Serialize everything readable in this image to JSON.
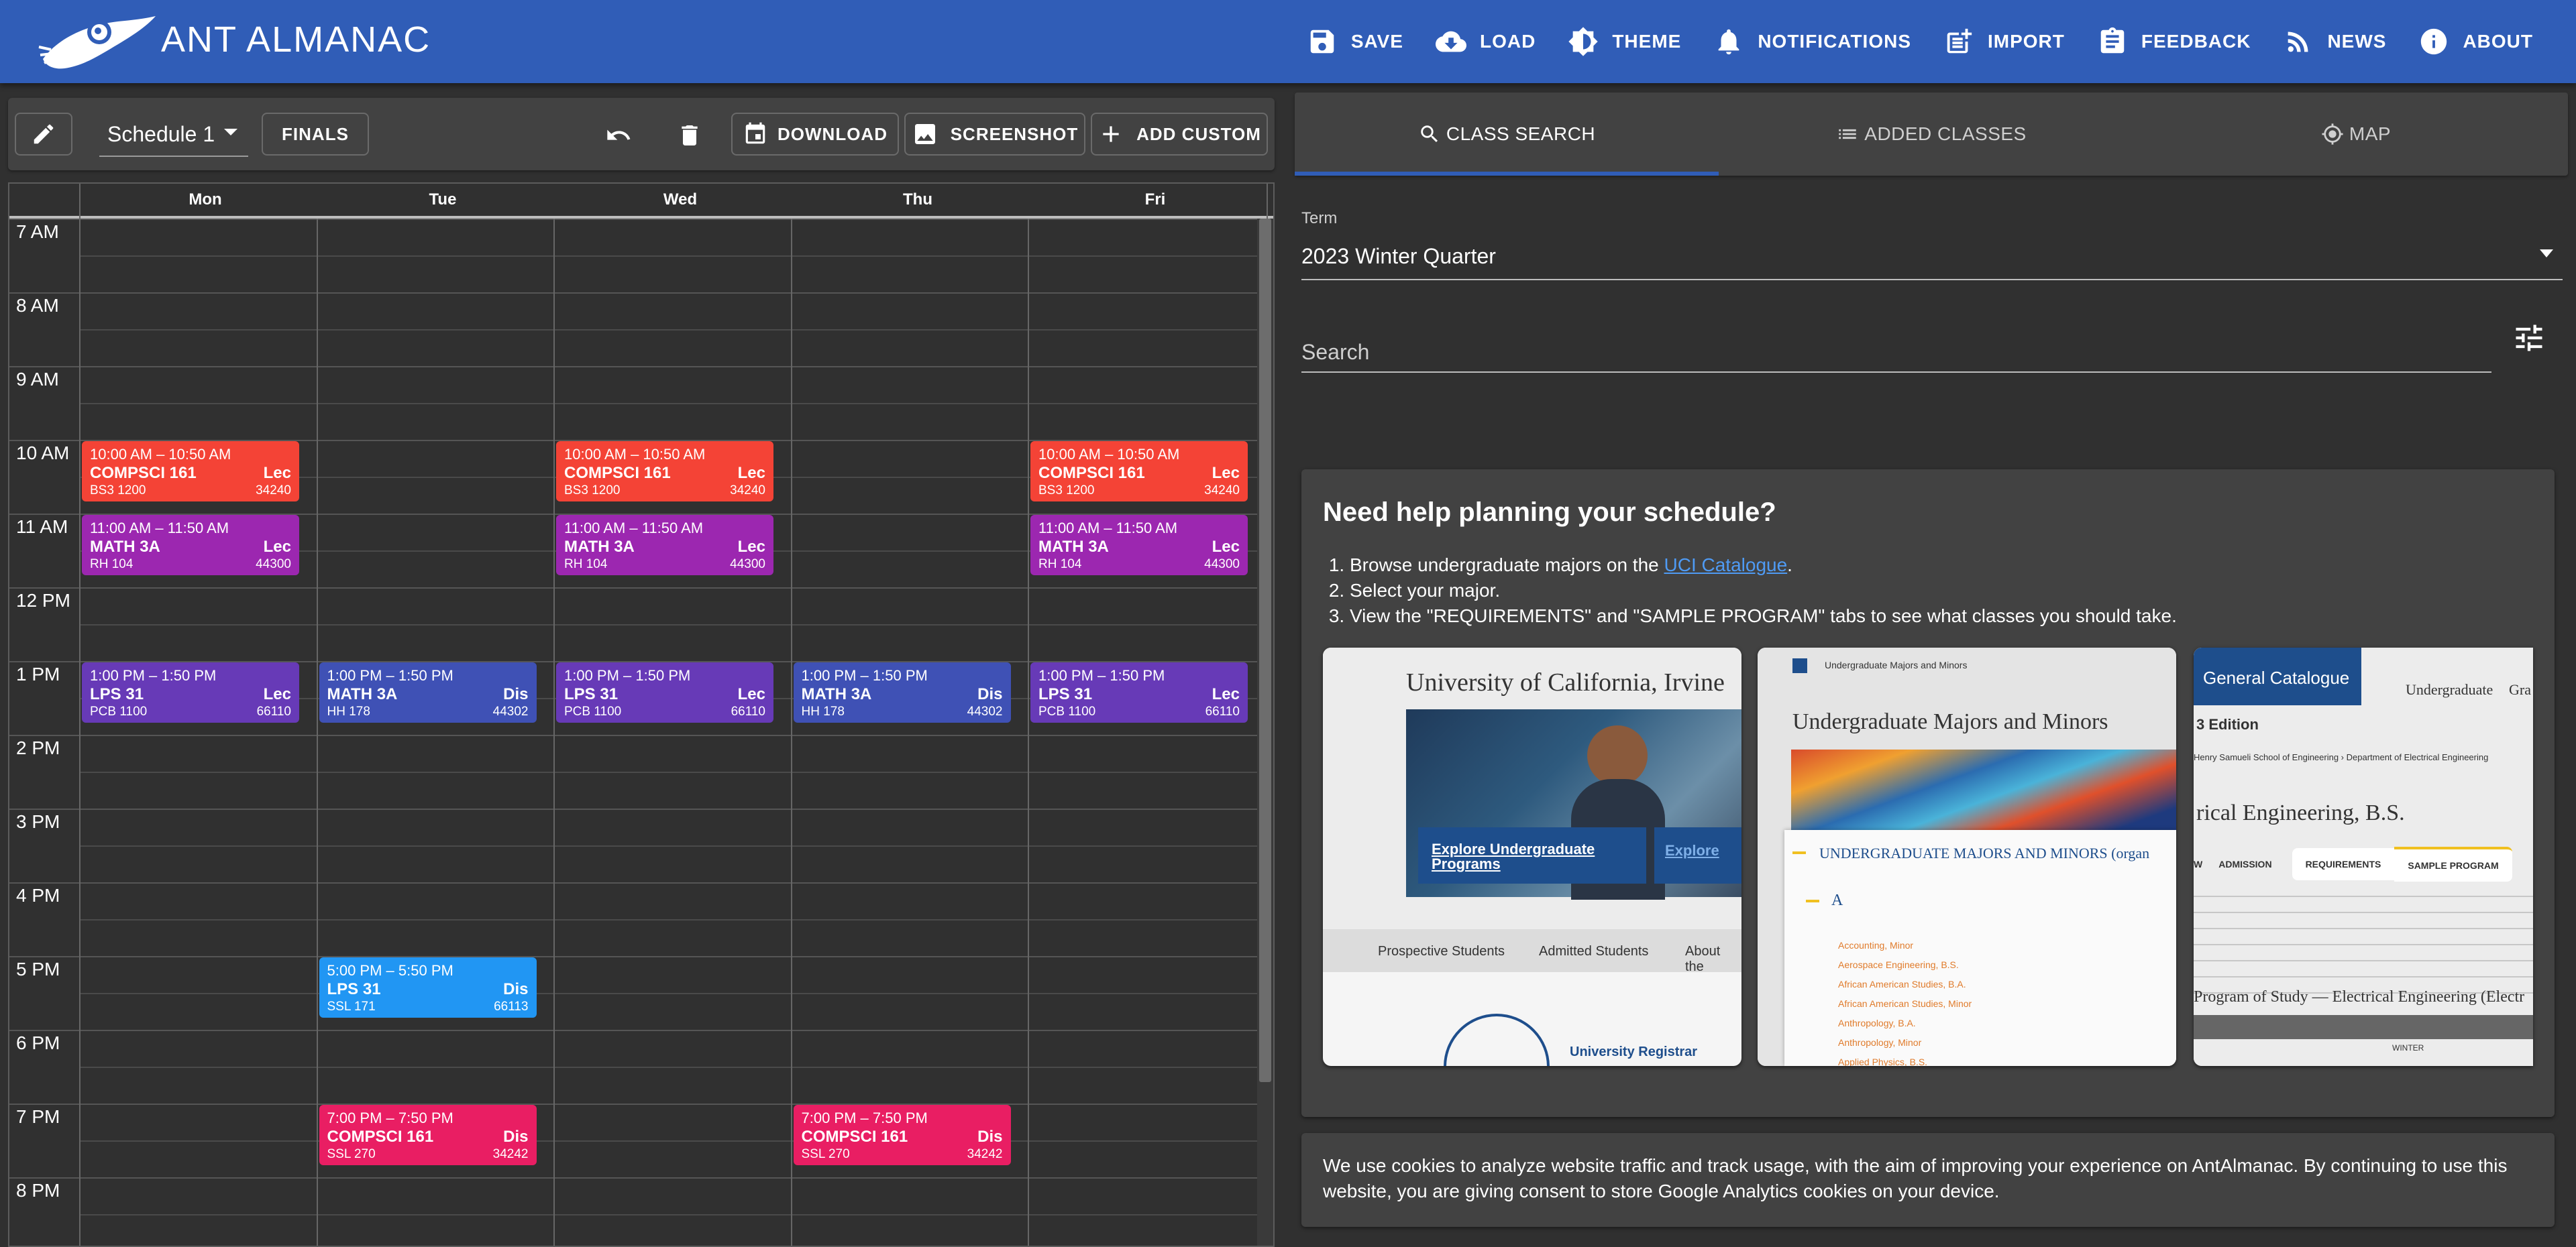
{
  "app": {
    "title": "ANT ALMANAC"
  },
  "nav": [
    {
      "label": "SAVE",
      "icon": "save-icon"
    },
    {
      "label": "LOAD",
      "icon": "cloud-download-icon"
    },
    {
      "label": "THEME",
      "icon": "brightness-icon"
    },
    {
      "label": "NOTIFICATIONS",
      "icon": "bell-icon"
    },
    {
      "label": "IMPORT",
      "icon": "post-add-icon"
    },
    {
      "label": "FEEDBACK",
      "icon": "clipboard-icon"
    },
    {
      "label": "NEWS",
      "icon": "rss-icon"
    },
    {
      "label": "ABOUT",
      "icon": "info-icon"
    }
  ],
  "toolbar": {
    "schedule_name": "Schedule 1",
    "finals_label": "FINALS",
    "download_label": "DOWNLOAD",
    "screenshot_label": "SCREENSHOT",
    "add_custom_label": "ADD CUSTOM"
  },
  "calendar": {
    "days": [
      "Mon",
      "Tue",
      "Wed",
      "Thu",
      "Fri"
    ],
    "hours": [
      "7 AM",
      "8 AM",
      "9 AM",
      "10 AM",
      "11 AM",
      "12 PM",
      "1 PM",
      "2 PM",
      "3 PM",
      "4 PM",
      "5 PM",
      "6 PM",
      "7 PM",
      "8 PM"
    ],
    "events": [
      {
        "day": 0,
        "start": 10,
        "time": "10:00 AM – 10:50 AM",
        "course": "COMPSCI 161",
        "type": "Lec",
        "room": "BS3 1200",
        "code": "34240",
        "color": "#f44336"
      },
      {
        "day": 2,
        "start": 10,
        "time": "10:00 AM – 10:50 AM",
        "course": "COMPSCI 161",
        "type": "Lec",
        "room": "BS3 1200",
        "code": "34240",
        "color": "#f44336"
      },
      {
        "day": 4,
        "start": 10,
        "time": "10:00 AM – 10:50 AM",
        "course": "COMPSCI 161",
        "type": "Lec",
        "room": "BS3 1200",
        "code": "34240",
        "color": "#f44336"
      },
      {
        "day": 0,
        "start": 11,
        "time": "11:00 AM – 11:50 AM",
        "course": "MATH 3A",
        "type": "Lec",
        "room": "RH 104",
        "code": "44300",
        "color": "#9c27b0"
      },
      {
        "day": 2,
        "start": 11,
        "time": "11:00 AM – 11:50 AM",
        "course": "MATH 3A",
        "type": "Lec",
        "room": "RH 104",
        "code": "44300",
        "color": "#9c27b0"
      },
      {
        "day": 4,
        "start": 11,
        "time": "11:00 AM – 11:50 AM",
        "course": "MATH 3A",
        "type": "Lec",
        "room": "RH 104",
        "code": "44300",
        "color": "#9c27b0"
      },
      {
        "day": 0,
        "start": 13,
        "time": "1:00 PM – 1:50 PM",
        "course": "LPS 31",
        "type": "Lec",
        "room": "PCB 1100",
        "code": "66110",
        "color": "#673ab7"
      },
      {
        "day": 2,
        "start": 13,
        "time": "1:00 PM – 1:50 PM",
        "course": "LPS 31",
        "type": "Lec",
        "room": "PCB 1100",
        "code": "66110",
        "color": "#673ab7"
      },
      {
        "day": 4,
        "start": 13,
        "time": "1:00 PM – 1:50 PM",
        "course": "LPS 31",
        "type": "Lec",
        "room": "PCB 1100",
        "code": "66110",
        "color": "#673ab7"
      },
      {
        "day": 1,
        "start": 13,
        "time": "1:00 PM – 1:50 PM",
        "course": "MATH 3A",
        "type": "Dis",
        "room": "HH 178",
        "code": "44302",
        "color": "#3f51b5"
      },
      {
        "day": 3,
        "start": 13,
        "time": "1:00 PM – 1:50 PM",
        "course": "MATH 3A",
        "type": "Dis",
        "room": "HH 178",
        "code": "44302",
        "color": "#3f51b5"
      },
      {
        "day": 1,
        "start": 17,
        "time": "5:00 PM – 5:50 PM",
        "course": "LPS 31",
        "type": "Dis",
        "room": "SSL 171",
        "code": "66113",
        "color": "#2196f3"
      },
      {
        "day": 1,
        "start": 19,
        "time": "7:00 PM – 7:50 PM",
        "course": "COMPSCI 161",
        "type": "Dis",
        "room": "SSL 270",
        "code": "34242",
        "color": "#e91e63"
      },
      {
        "day": 3,
        "start": 19,
        "time": "7:00 PM – 7:50 PM",
        "course": "COMPSCI 161",
        "type": "Dis",
        "room": "SSL 270",
        "code": "34242",
        "color": "#e91e63"
      }
    ]
  },
  "tabs": [
    {
      "label": "CLASS SEARCH",
      "icon": "search-icon",
      "active": true
    },
    {
      "label": "ADDED CLASSES",
      "icon": "list-icon",
      "active": false
    },
    {
      "label": "MAP",
      "icon": "location-icon",
      "active": false
    }
  ],
  "search": {
    "term_label": "Term",
    "term_value": "2023 Winter Quarter",
    "placeholder": "Search"
  },
  "help": {
    "title": "Need help planning your schedule?",
    "step1_prefix": "Browse undergraduate majors on the ",
    "step1_link": "UCI Catalogue",
    "step1_suffix": ".",
    "step2": "Select your major.",
    "step3": "View the \"REQUIREMENTS\" and \"SAMPLE PROGRAM\" tabs to see what classes you should take.",
    "shot1": {
      "heading": "University of California, Irvine",
      "button": "Explore Undergraduate Programs",
      "button2": "Explore",
      "nav": [
        "Prospective Students",
        "Admitted Students",
        "About the"
      ],
      "footer": "University Registrar"
    },
    "shot2": {
      "crumb": "Undergraduate Majors and Minors",
      "heading": "Undergraduate Majors and Minors",
      "section": "UNDERGRADUATE MAJORS AND MINORS (organ",
      "letter": "A",
      "items": [
        "Accounting, Minor",
        "Aerospace Engineering, B.S.",
        "African American Studies, B.A.",
        "African American Studies, Minor",
        "Anthropology, B.A.",
        "Anthropology, Minor",
        "Applied Physics, B.S."
      ]
    },
    "shot3": {
      "brand": "General Catalogue",
      "tab": "Undergraduate",
      "tab2": "Gra",
      "edition": "3 Edition",
      "crumb": "Henry Samueli School of Engineering  ›  Department of Electrical Engineering",
      "heading": "rical Engineering, B.S.",
      "tabs": [
        "W",
        "ADMISSION",
        "REQUIREMENTS",
        "SAMPLE PROGRAM"
      ],
      "program": "Program of Study — Electrical Engineering (Electr",
      "col": "WINTER"
    }
  },
  "cookie": {
    "text": "We use cookies to analyze website traffic and track usage, with the aim of improving your experience on AntAlmanac. By continuing to use this website, you are giving consent to store Google Analytics cookies on your device."
  }
}
